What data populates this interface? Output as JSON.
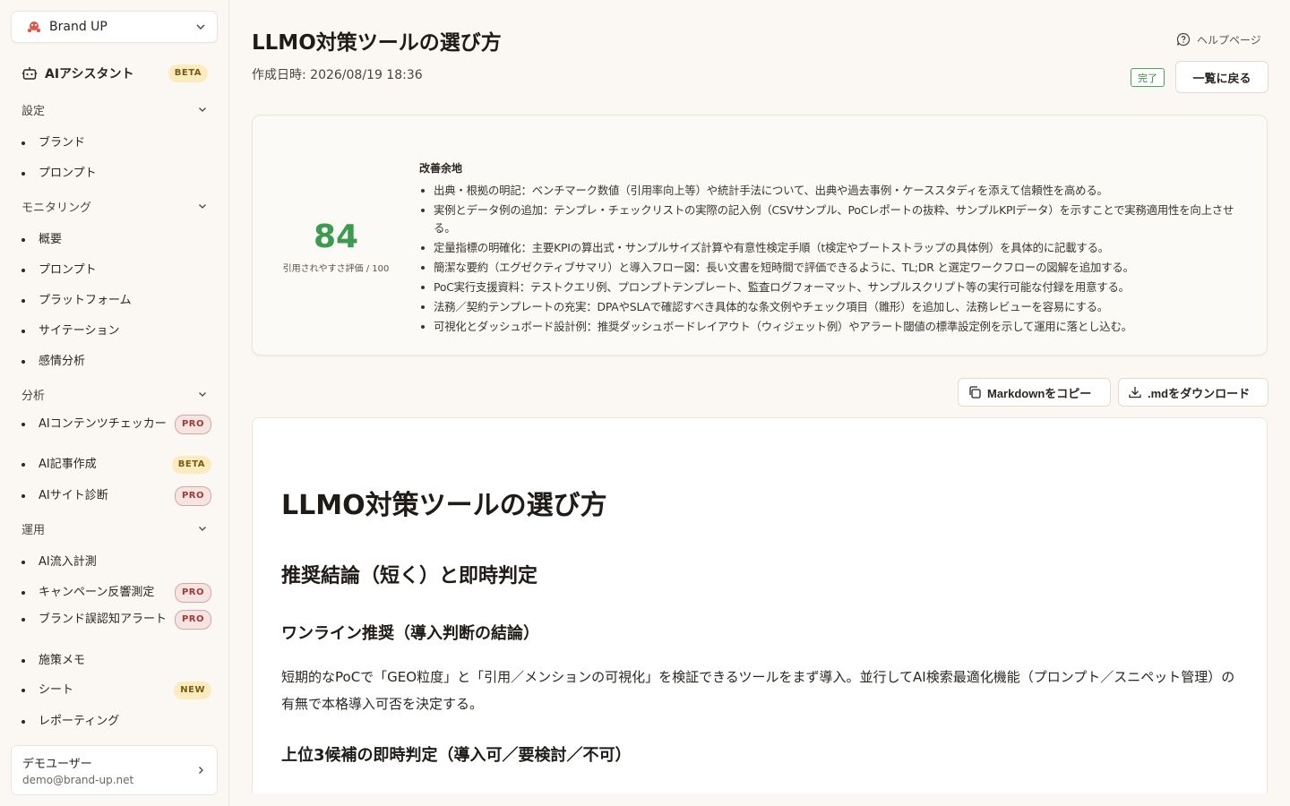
{
  "app": {
    "brand_name": "Brand UP",
    "accent": "#3c9b4f"
  },
  "sidebar": {
    "ai_assistant": {
      "label": "AIアシスタント",
      "badge": "BETA"
    },
    "sections": [
      {
        "title": "設定",
        "items": [
          {
            "label": "ブランド"
          },
          {
            "label": "プロンプト"
          }
        ]
      },
      {
        "title": "モニタリング",
        "items": [
          {
            "label": "概要"
          },
          {
            "label": "プロンプト"
          },
          {
            "label": "プラットフォーム"
          },
          {
            "label": "サイテーション"
          },
          {
            "label": "感情分析"
          }
        ]
      },
      {
        "title": "分析",
        "items": [
          {
            "label": "AIコンテンツチェッカー",
            "badge": "PRO"
          },
          {
            "label": "AI記事作成",
            "badge": "BETA"
          },
          {
            "label": "AIサイト診断",
            "badge": "PRO"
          }
        ]
      },
      {
        "title": "運用",
        "items": [
          {
            "label": "AI流入計測"
          },
          {
            "label": "キャンペーン反響測定",
            "badge": "PRO"
          },
          {
            "label": "ブランド誤認知アラート",
            "badge": "PRO"
          },
          {
            "label": "施策メモ"
          },
          {
            "label": "シート",
            "badge": "NEW"
          },
          {
            "label": "レポーティング"
          }
        ]
      }
    ],
    "user": {
      "name": "デモユーザー",
      "email": "demo@brand-up.net"
    }
  },
  "header": {
    "title": "LLMO対策ツールの選び方",
    "created": "作成日時: 2026/08/19 18:36",
    "help_label": "ヘルプページ",
    "status": "完了",
    "back_label": "一覧に戻る"
  },
  "score": {
    "value": "84",
    "caption": "引用されやすさ評価 / 100",
    "improve_title": "改善余地",
    "items": [
      "出典・根拠の明記：ベンチマーク数値（引用率向上等）や統計手法について、出典や過去事例・ケーススタディを添えて信頼性を高める。",
      "実例とデータ例の追加：テンプレ・チェックリストの実際の記入例（CSVサンプル、PoCレポートの抜粋、サンプルKPIデータ）を示すことで実務適用性を向上させる。",
      "定量指標の明確化：主要KPIの算出式・サンプルサイズ計算や有意性検定手順（t検定やブートストラップの具体例）を具体的に記載する。",
      "簡潔な要約（エグゼクティブサマリ）と導入フロー図：長い文書を短時間で評価できるように、TL;DR と選定ワークフローの図解を追加する。",
      "PoC実行支援資料：テストクエリ例、プロンプトテンプレート、監査ログフォーマット、サンプルスクリプト等の実行可能な付録を用意する。",
      "法務／契約テンプレートの充実：DPAやSLAで確認すべき具体的な条文例やチェック項目（雛形）を追加し、法務レビューを容易にする。",
      "可視化とダッシュボード設計例：推奨ダッシュボードレイアウト（ウィジェット例）やアラート閾値の標準設定例を示して運用に落とし込む。"
    ]
  },
  "actions": {
    "copy_label": "Markdownをコピー",
    "download_label": ".mdをダウンロード"
  },
  "document": {
    "h1": "LLMO対策ツールの選び方",
    "h2": "推奨結論（短く）と即時判定",
    "h3_1": "ワンライン推奨（導入判断の結論）",
    "p1": "短期的なPoCで「GEO粒度」と「引用／メンションの可視化」を検証できるツールをまず導入。並行してAI検索最適化機能（プロンプト／スニペット管理）の有無で本格導入可否を決定する。",
    "h3_2": "上位3候補の即時判定（導入可／要検討／不可）"
  }
}
